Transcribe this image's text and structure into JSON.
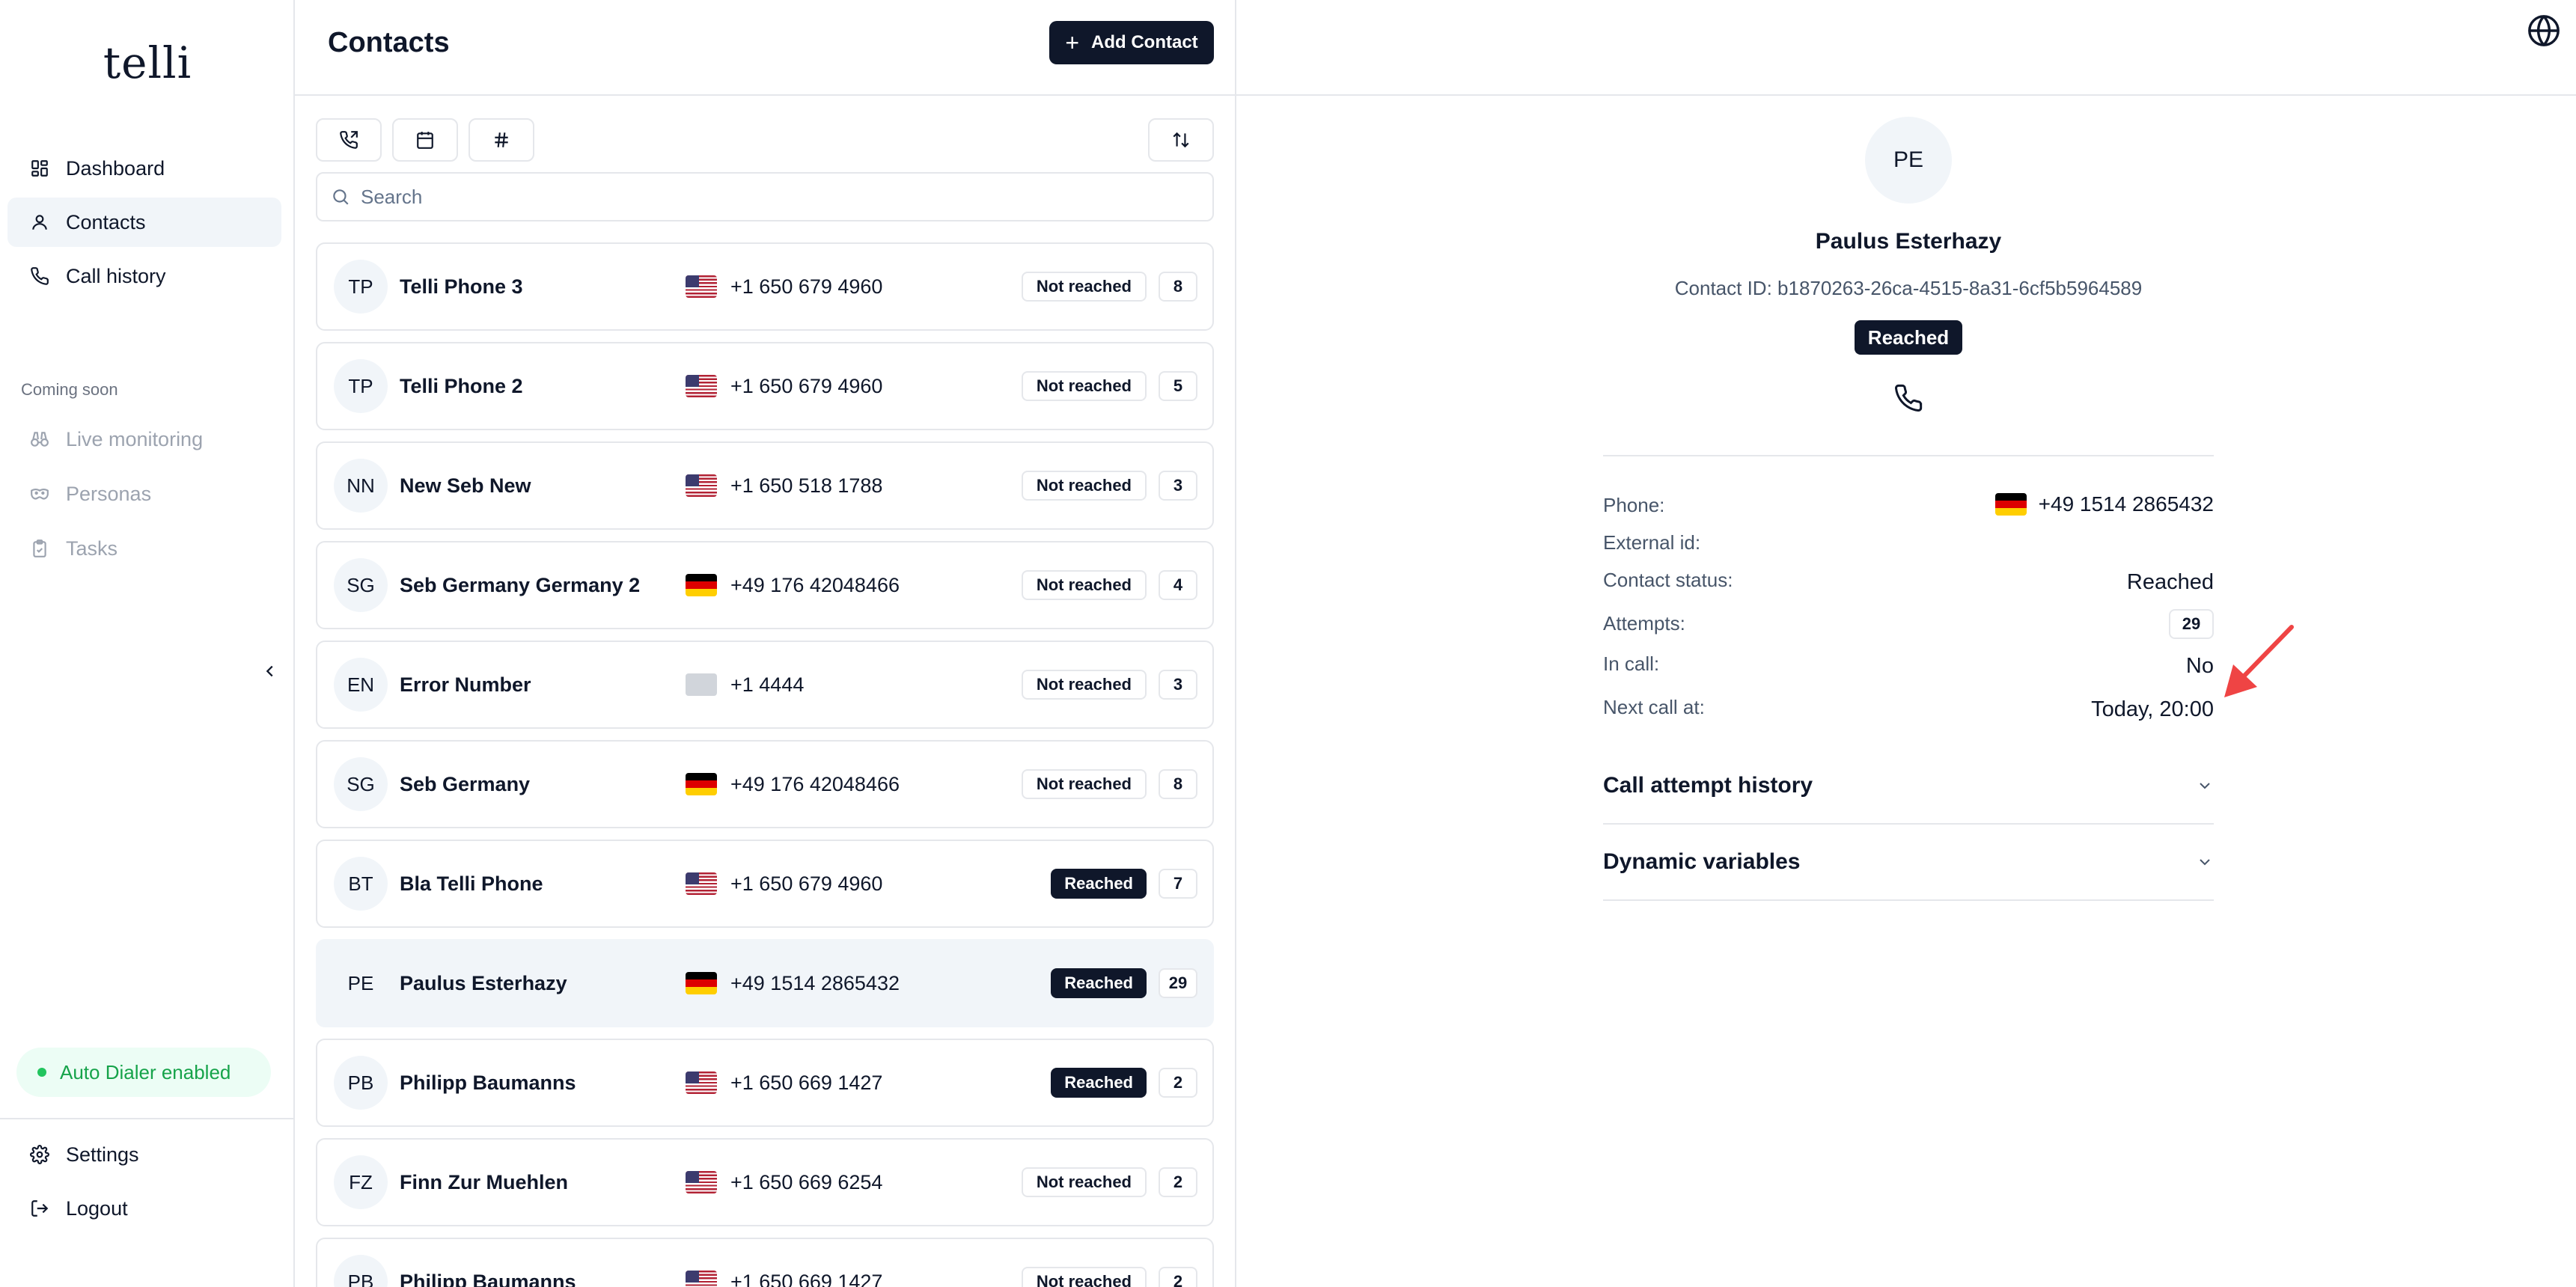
{
  "sidebar": {
    "logo": "telli",
    "nav": [
      {
        "label": "Dashboard",
        "icon": "dashboard-icon",
        "active": false
      },
      {
        "label": "Contacts",
        "icon": "user-icon",
        "active": true
      },
      {
        "label": "Call history",
        "icon": "phone-icon",
        "active": false
      }
    ],
    "coming_soon_label": "Coming soon",
    "coming_soon": [
      {
        "label": "Live monitoring",
        "icon": "binoculars-icon"
      },
      {
        "label": "Personas",
        "icon": "mask-icon"
      },
      {
        "label": "Tasks",
        "icon": "clipboard-icon"
      }
    ],
    "auto_dialer": "Auto Dialer enabled",
    "settings": "Settings",
    "logout": "Logout"
  },
  "contacts": {
    "title": "Contacts",
    "add_button": "Add Contact",
    "search_placeholder": "Search",
    "rows": [
      {
        "initials": "TP",
        "name": "Telli Phone 3",
        "flag": "us",
        "phone": "+1 650 679 4960",
        "status": "Not reached",
        "reached": false,
        "count": "8"
      },
      {
        "initials": "TP",
        "name": "Telli Phone 2",
        "flag": "us",
        "phone": "+1 650 679 4960",
        "status": "Not reached",
        "reached": false,
        "count": "5"
      },
      {
        "initials": "NN",
        "name": "New Seb New",
        "flag": "us",
        "phone": "+1 650 518 1788",
        "status": "Not reached",
        "reached": false,
        "count": "3"
      },
      {
        "initials": "SG",
        "name": "Seb Germany Germany 2",
        "flag": "de",
        "phone": "+49 176 42048466",
        "status": "Not reached",
        "reached": false,
        "count": "4"
      },
      {
        "initials": "EN",
        "name": "Error Number",
        "flag": "none",
        "phone": "+1 4444",
        "status": "Not reached",
        "reached": false,
        "count": "3"
      },
      {
        "initials": "SG",
        "name": "Seb Germany",
        "flag": "de",
        "phone": "+49 176 42048466",
        "status": "Not reached",
        "reached": false,
        "count": "8"
      },
      {
        "initials": "BT",
        "name": "Bla Telli Phone",
        "flag": "us",
        "phone": "+1 650 679 4960",
        "status": "Reached",
        "reached": true,
        "count": "7"
      },
      {
        "initials": "PE",
        "name": "Paulus Esterhazy",
        "flag": "de",
        "phone": "+49 1514 2865432",
        "status": "Reached",
        "reached": true,
        "count": "29",
        "selected": true
      },
      {
        "initials": "PB",
        "name": "Philipp Baumanns",
        "flag": "us",
        "phone": "+1 650 669 1427",
        "status": "Reached",
        "reached": true,
        "count": "2"
      },
      {
        "initials": "FZ",
        "name": "Finn Zur Muehlen",
        "flag": "us",
        "phone": "+1 650 669 6254",
        "status": "Not reached",
        "reached": false,
        "count": "2"
      },
      {
        "initials": "PB",
        "name": "Philipp Baumanns",
        "flag": "us",
        "phone": "+1 650 669 1427",
        "status": "Not reached",
        "reached": false,
        "count": "2"
      }
    ]
  },
  "detail": {
    "initials": "PE",
    "name": "Paulus Esterhazy",
    "contact_id": "Contact ID: b1870263-26ca-4515-8a31-6cf5b5964589",
    "badge": "Reached",
    "fields": {
      "phone_label": "Phone:",
      "phone_value": "+49 1514 2865432",
      "external_label": "External id:",
      "status_label": "Contact status:",
      "status_value": "Reached",
      "attempts_label": "Attempts:",
      "attempts_value": "29",
      "incall_label": "In call:",
      "incall_value": "No",
      "next_label": "Next call at:",
      "next_value": "Today, 20:00"
    },
    "sections": [
      "Call attempt history",
      "Dynamic variables"
    ]
  },
  "colors": {
    "primary": "#0f172a",
    "muted": "#475569",
    "border": "#e5e7eb",
    "success": "#16a34a",
    "annotation": "#ef4444"
  }
}
